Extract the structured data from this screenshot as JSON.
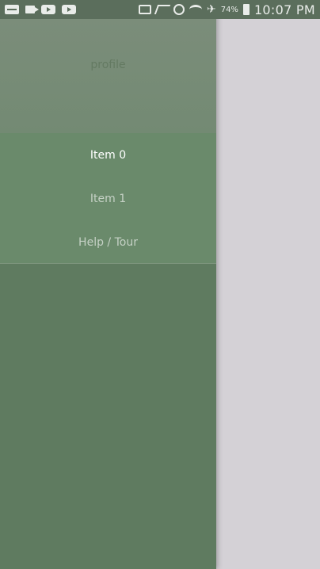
{
  "status_bar": {
    "left_icons": [
      "message-icon",
      "video-icon",
      "play-icon",
      "play-icon"
    ],
    "right_icons": [
      "cast-icon",
      "mute-icon",
      "alarm-icon",
      "wifi-icon",
      "airplane-icon"
    ],
    "battery_percent": "74%",
    "time": "10:07 PM"
  },
  "drawer": {
    "profile_label": "profile",
    "items": [
      {
        "label": "Item 0"
      },
      {
        "label": "Item 1"
      },
      {
        "label": "Help / Tour"
      }
    ]
  },
  "colors": {
    "drawer_bg": "#5e7b5f",
    "header_bg": "#738a73",
    "menu_bg": "#6a8a6b",
    "content_bg": "#d4d1d6"
  }
}
